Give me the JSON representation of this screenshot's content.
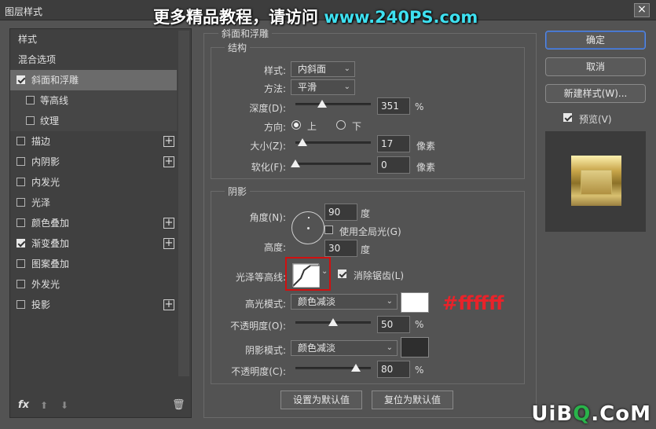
{
  "title": "图层样式",
  "watermark": {
    "text": "更多精品教程，请访问 ",
    "url": "www.240PS.com"
  },
  "left_panel": {
    "header": "样式",
    "blend_options": "混合选项",
    "items": [
      {
        "label": "斜面和浮雕",
        "checked": true,
        "selected": true,
        "plus": false
      },
      {
        "label": "等高线",
        "checked": false,
        "sub": true,
        "plus": false
      },
      {
        "label": "纹理",
        "checked": false,
        "sub": true,
        "plus": false
      },
      {
        "label": "描边",
        "checked": false,
        "plus": true
      },
      {
        "label": "内阴影",
        "checked": false,
        "plus": true
      },
      {
        "label": "内发光",
        "checked": false,
        "plus": false
      },
      {
        "label": "光泽",
        "checked": false,
        "plus": false
      },
      {
        "label": "颜色叠加",
        "checked": false,
        "plus": true
      },
      {
        "label": "渐变叠加",
        "checked": true,
        "plus": true
      },
      {
        "label": "图案叠加",
        "checked": false,
        "plus": false
      },
      {
        "label": "外发光",
        "checked": false,
        "plus": false
      },
      {
        "label": "投影",
        "checked": false,
        "plus": true
      }
    ],
    "fx": "fx"
  },
  "bevel": {
    "section_title": "斜面和浮雕",
    "structure_title": "结构",
    "style_label": "样式:",
    "style_value": "内斜面",
    "technique_label": "方法:",
    "technique_value": "平滑",
    "depth_label": "深度(D):",
    "depth_value": "351",
    "depth_unit": "%",
    "depth_level": 0.35,
    "direction_label": "方向:",
    "direction_up": "上",
    "direction_down": "下",
    "size_label": "大小(Z):",
    "size_value": "17",
    "size_unit": "像素",
    "size_level": 0.09,
    "soften_label": "软化(F):",
    "soften_value": "0",
    "soften_unit": "像素",
    "soften_level": 0.0
  },
  "shading": {
    "title": "阴影",
    "angle_label": "角度(N):",
    "angle_value": "90",
    "angle_unit": "度",
    "global_light": "使用全局光(G)",
    "altitude_label": "高度:",
    "altitude_value": "30",
    "altitude_unit": "度",
    "gloss_contour_label": "光泽等高线:",
    "anti_aliased": "消除锯齿(L)",
    "highlight_mode_label": "高光模式:",
    "highlight_mode_value": "颜色减淡",
    "highlight_color": "#ffffff",
    "highlight_opacity_label": "不透明度(O):",
    "highlight_opacity_value": "50",
    "highlight_opacity_unit": "%",
    "highlight_opacity_level": 0.5,
    "shadow_mode_label": "阴影模式:",
    "shadow_mode_value": "颜色减淡",
    "shadow_color": "#2e2e2e",
    "shadow_opacity_label": "不透明度(C):",
    "shadow_opacity_value": "80",
    "shadow_opacity_unit": "%",
    "shadow_opacity_level": 0.8
  },
  "annotation": "#ffffff",
  "buttons": {
    "set_default": "设置为默认值",
    "reset_default": "复位为默认值",
    "ok": "确定",
    "cancel": "取消",
    "new_style": "新建样式(W)...",
    "preview": "预览(V)"
  },
  "bottom_watermark": {
    "a": "UiB",
    "b": "Q",
    "c": ".CoM"
  }
}
